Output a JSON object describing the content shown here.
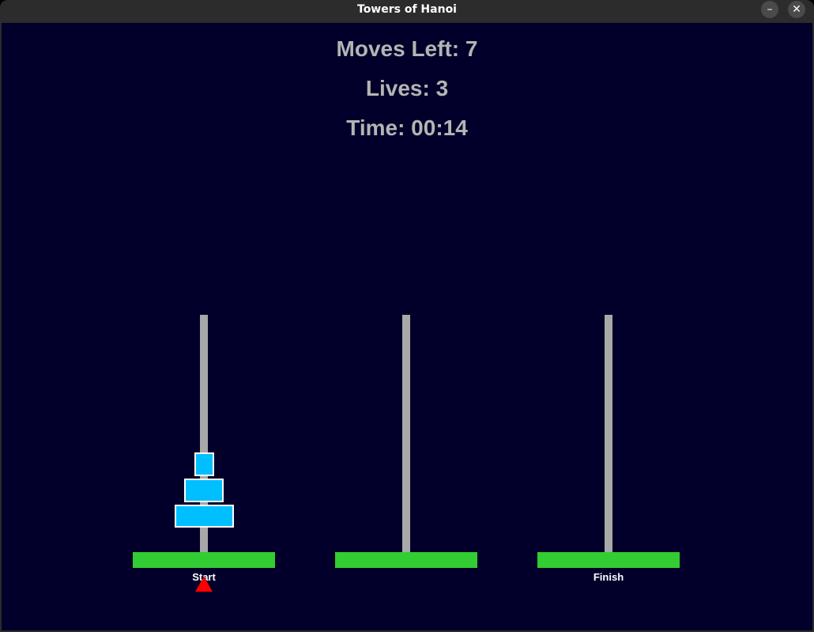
{
  "window": {
    "title": "Towers of Hanoi",
    "minimize_glyph": "–",
    "close_glyph": "✕"
  },
  "hud": {
    "moves_left": "Moves Left: 7",
    "lives": "Lives: 3",
    "time": "Time: 00:14"
  },
  "towers": [
    {
      "label": "Start",
      "disk_count": 3
    },
    {
      "label": "",
      "disk_count": 0
    },
    {
      "label": "Finish",
      "disk_count": 0
    }
  ],
  "selected_tower": "Start",
  "colors": {
    "background": "#02002a",
    "text": "#b4b4b4",
    "peg": "#a8a8a8",
    "base": "#32cd32",
    "disk": "#00bfff",
    "disk_border": "#ffffff",
    "selector": "#ff0000"
  }
}
